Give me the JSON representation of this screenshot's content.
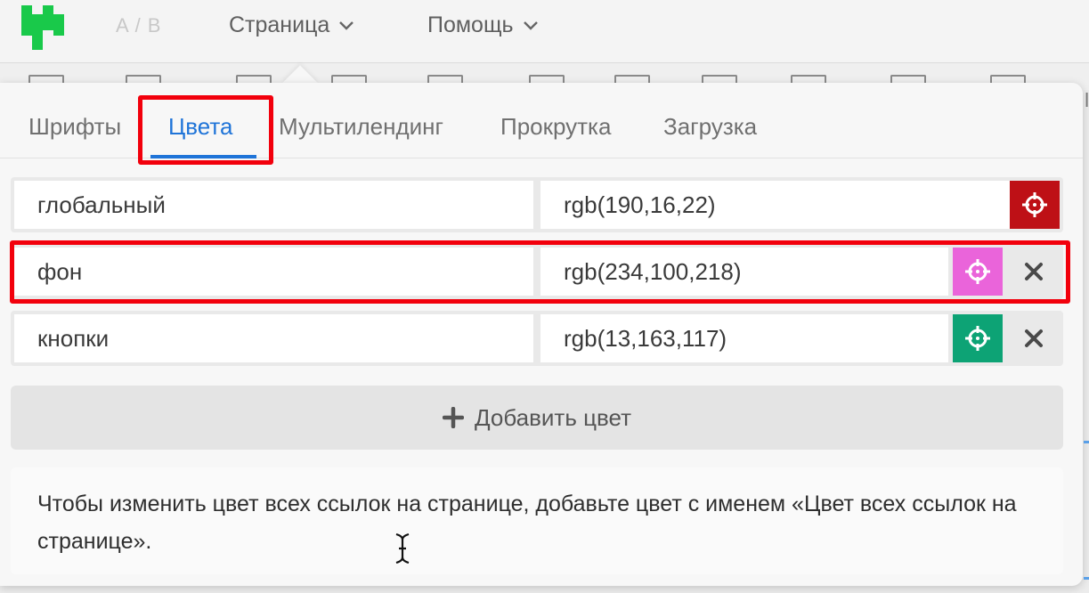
{
  "topbar": {
    "ab_label": "A / B",
    "menu_page": "Страница",
    "menu_help": "Помощь"
  },
  "tabs": [
    {
      "label": "Шрифты",
      "active": false
    },
    {
      "label": "Цвета",
      "active": true
    },
    {
      "label": "Мультилендинг",
      "active": false
    },
    {
      "label": "Прокрутка",
      "active": false
    },
    {
      "label": "Загрузка",
      "active": false
    }
  ],
  "colors": [
    {
      "name": "глобальный",
      "value": "rgb(190,16,22)",
      "swatch": "#be1016",
      "removable": false
    },
    {
      "name": "фон",
      "value": "rgb(234,100,218)",
      "swatch": "#ea64da",
      "removable": true
    },
    {
      "name": "кнопки",
      "value": "rgb(13,163,117)",
      "swatch": "#0da375",
      "removable": true
    }
  ],
  "add_color_label": "Добавить цвет",
  "hint": "Чтобы изменить цвет всех ссылок на странице, добавьте цвет с именем «Цвет всех ссылок на странице».",
  "icons": {
    "logo": "brand-logo",
    "menu_chevron": "chevron-down-icon",
    "swatch": "crosshair-icon",
    "remove": "close-icon",
    "add": "plus-icon"
  },
  "theme": {
    "accent": "#1f74d8",
    "brand_green": "#19c94a",
    "highlight_red": "#f2000c"
  }
}
